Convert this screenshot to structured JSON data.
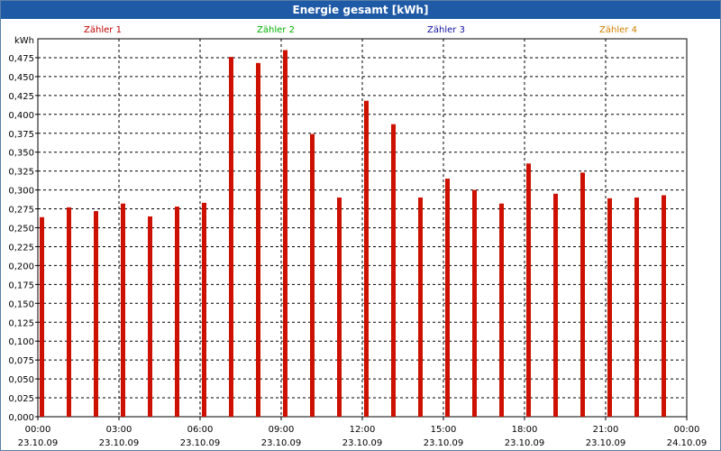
{
  "window": {
    "title": "Energie gesamt [kWh]"
  },
  "legend": [
    {
      "label": "Zähler 1",
      "color": "#c00000"
    },
    {
      "label": "Zähler 2",
      "color": "#00b000"
    },
    {
      "label": "Zähler 3",
      "color": "#1010a0"
    },
    {
      "label": "Zähler 4",
      "color": "#d08000"
    }
  ],
  "chart_data": {
    "type": "bar",
    "title": "Energie gesamt [kWh]",
    "ylabel": "kWh",
    "ylim": [
      0,
      0.5
    ],
    "y_ticks": [
      "0,000",
      "0,025",
      "0,050",
      "0,075",
      "0,100",
      "0,125",
      "0,150",
      "0,175",
      "0,200",
      "0,225",
      "0,250",
      "0,275",
      "0,300",
      "0,325",
      "0,350",
      "0,375",
      "0,400",
      "0,425",
      "0,450",
      "0,475"
    ],
    "x_ticks": [
      {
        "time": "00:00",
        "date": "23.10.09"
      },
      {
        "time": "03:00",
        "date": "23.10.09"
      },
      {
        "time": "06:00",
        "date": "23.10.09"
      },
      {
        "time": "09:00",
        "date": "23.10.09"
      },
      {
        "time": "12:00",
        "date": "23.10.09"
      },
      {
        "time": "15:00",
        "date": "23.10.09"
      },
      {
        "time": "18:00",
        "date": "23.10.09"
      },
      {
        "time": "21:00",
        "date": "23.10.09"
      },
      {
        "time": "00:00",
        "date": "24.10.09"
      }
    ],
    "grid": true,
    "bar_color": "#cc1100",
    "series": [
      {
        "name": "Zähler 1",
        "x": [
          "00:00",
          "01:00",
          "02:00",
          "03:00",
          "04:00",
          "05:00",
          "06:00",
          "07:00",
          "08:00",
          "09:00",
          "10:00",
          "11:00",
          "12:00",
          "13:00",
          "14:00",
          "15:00",
          "16:00",
          "17:00",
          "18:00",
          "19:00",
          "20:00",
          "21:00",
          "22:00",
          "23:00"
        ],
        "values": [
          0.264,
          0.277,
          0.272,
          0.282,
          0.265,
          0.278,
          0.283,
          0.476,
          0.468,
          0.485,
          0.374,
          0.29,
          0.418,
          0.387,
          0.29,
          0.315,
          0.3,
          0.282,
          0.335,
          0.295,
          0.323,
          0.289,
          0.29,
          0.293
        ]
      }
    ]
  }
}
